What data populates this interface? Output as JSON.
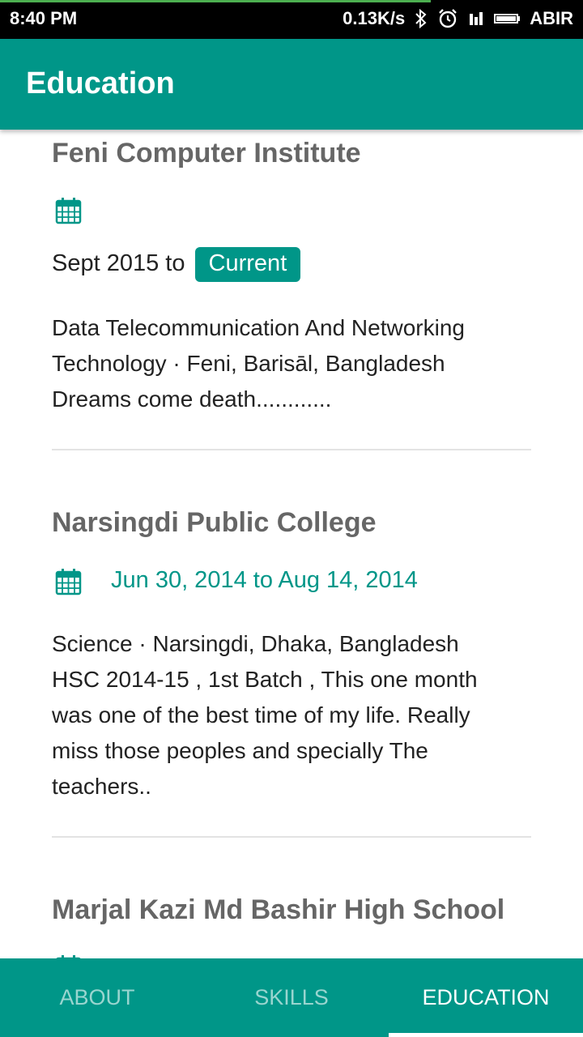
{
  "status_bar": {
    "time": "8:40 PM",
    "network_speed": "0.13K/s",
    "carrier": "ABIR",
    "icons": [
      "bluetooth-icon",
      "alarm-icon",
      "signal-icon",
      "battery-icon"
    ]
  },
  "app_bar": {
    "title": "Education"
  },
  "education": [
    {
      "school": "Feni Computer Institute",
      "date_text": "Sept 2015 to",
      "badge": "Current",
      "desc_lines": [
        "Data Telecommunication And Networking",
        "Technology · Feni, Barisāl, Bangladesh",
        "Dreams come death............"
      ]
    },
    {
      "school": "Narsingdi Public College",
      "date_text": "Jun 30, 2014 to Aug 14, 2014",
      "desc_lines": [
        "Science · Narsingdi, Dhaka, Bangladesh",
        "HSC 2014-15 , 1st Batch , This one month",
        "was one of the best time of my life. Really",
        "miss those peoples and specially The",
        "teachers.."
      ]
    },
    {
      "school": "Marjal Kazi Md Bashir High School"
    }
  ],
  "bottom_nav": {
    "tabs": [
      "ABOUT",
      "SKILLS",
      "EDUCATION"
    ],
    "active": "EDUCATION"
  },
  "colors": {
    "primary": "#009688",
    "school_title": "#666666",
    "text": "#222222",
    "divider": "#e3e3e3"
  }
}
